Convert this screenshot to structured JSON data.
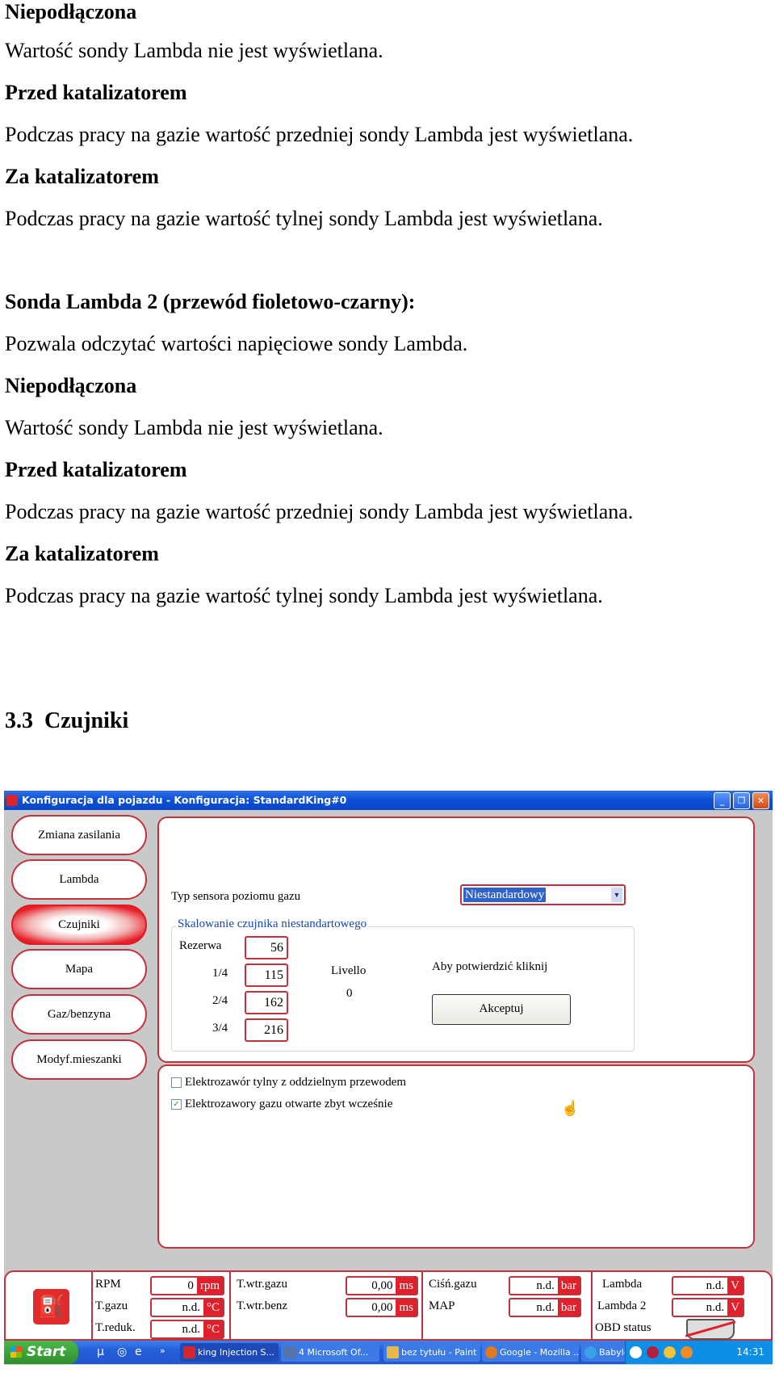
{
  "document": {
    "section1": [
      {
        "text": "Niepodłączona",
        "bold": true
      },
      {
        "text": "Wartość sondy Lambda nie jest wyświetlana.",
        "bold": false
      },
      {
        "text": "Przed katalizatorem",
        "bold": true
      },
      {
        "text": "Podczas pracy na gazie wartość przedniej sondy Lambda jest wyświetlana.",
        "bold": false
      },
      {
        "text": "Za katalizatorem",
        "bold": true
      },
      {
        "text": "Podczas pracy na gazie wartość tylnej sondy Lambda jest wyświetlana.",
        "bold": false
      }
    ],
    "section2": [
      {
        "text": "Sonda Lambda 2 (przewód fioletowo-czarny):",
        "bold": true
      },
      {
        "text": "Pozwala odczytać wartości napięciowe sondy Lambda.",
        "bold": false
      },
      {
        "text": "Niepodłączona",
        "bold": true
      },
      {
        "text": "Wartość sondy Lambda nie jest wyświetlana.",
        "bold": false
      },
      {
        "text": "Przed katalizatorem",
        "bold": true
      },
      {
        "text": "Podczas pracy na gazie wartość przedniej sondy Lambda jest wyświetlana.",
        "bold": false
      },
      {
        "text": "Za katalizatorem",
        "bold": true
      },
      {
        "text": "Podczas pracy na gazie wartość tylnej sondy Lambda jest wyświetlana.",
        "bold": false
      }
    ],
    "heading": {
      "number": "3.3",
      "title": "Czujniki"
    }
  },
  "window": {
    "title": "Konfiguracja dla pojazdu - Konfiguracja: StandardKing#0",
    "controls": {
      "minimize": "_",
      "restore": "❐",
      "close": "✕"
    },
    "nav": [
      {
        "label": "Zmiana zasilania",
        "active": false
      },
      {
        "label": "Lambda",
        "active": false
      },
      {
        "label": "Czujniki",
        "active": true
      },
      {
        "label": "Mapa",
        "active": false
      },
      {
        "label": "Gaz/benzyna",
        "active": false
      },
      {
        "label": "Modyf.mieszanki",
        "active": false
      }
    ],
    "sensor": {
      "type_label": "Typ sensora poziomu gazu",
      "type_value": "Niestandardowy",
      "group_title": "Skalowanie czujnika niestandartowego",
      "rows": [
        {
          "label": "Rezerwa",
          "value": "56"
        },
        {
          "label": "1/4",
          "value": "115"
        },
        {
          "label": "2/4",
          "value": "162"
        },
        {
          "label": "3/4",
          "value": "216"
        }
      ],
      "level_label": "Livello",
      "level_value": "0",
      "confirm_hint": "Aby potwierdzić kliknij",
      "accept_label": "Akceptuj"
    },
    "options": [
      {
        "label": "Elektrozawór tylny z oddzielnym przewodem",
        "checked": false
      },
      {
        "label": "Elektrozawory gazu otwarte zbyt wcześnie",
        "checked": true
      }
    ],
    "status": {
      "col1": [
        {
          "label": "RPM",
          "value": "0",
          "unit": "rpm"
        },
        {
          "label": "T.gazu",
          "value": "n.d.",
          "unit": "°C"
        },
        {
          "label": "T.reduk.",
          "value": "n.d.",
          "unit": "°C"
        }
      ],
      "col2": [
        {
          "label": "T.wtr.gazu",
          "value": "0,00",
          "unit": "ms"
        },
        {
          "label": "T.wtr.benz",
          "value": "0,00",
          "unit": "ms"
        }
      ],
      "col3": [
        {
          "label": "Ciśń.gazu",
          "value": "n.d.",
          "unit": "bar"
        },
        {
          "label": "MAP",
          "value": "n.d.",
          "unit": "bar"
        }
      ],
      "col4": [
        {
          "label": "Lambda",
          "value": "n.d.",
          "unit": "V"
        },
        {
          "label": "Lambda 2",
          "value": "n.d.",
          "unit": "V"
        }
      ],
      "obd_label": "OBD status",
      "obd_state": "disconnected"
    }
  },
  "taskbar": {
    "start_label": "Start",
    "tasks": [
      {
        "label": "king Injection S...",
        "active": true
      },
      {
        "label": "4 Microsoft Of...",
        "active": false
      },
      {
        "label": "bez tytułu - Paint",
        "active": false
      },
      {
        "label": "Google - Mozilla ...",
        "active": false
      },
      {
        "label": "Babylon Search ...",
        "active": false
      }
    ],
    "clock": "14:31"
  },
  "colors": {
    "accent_red": "#c2323a",
    "unit_red": "#e0202a",
    "selection_blue": "#2f62c9",
    "group_title_blue": "#1847a8"
  }
}
